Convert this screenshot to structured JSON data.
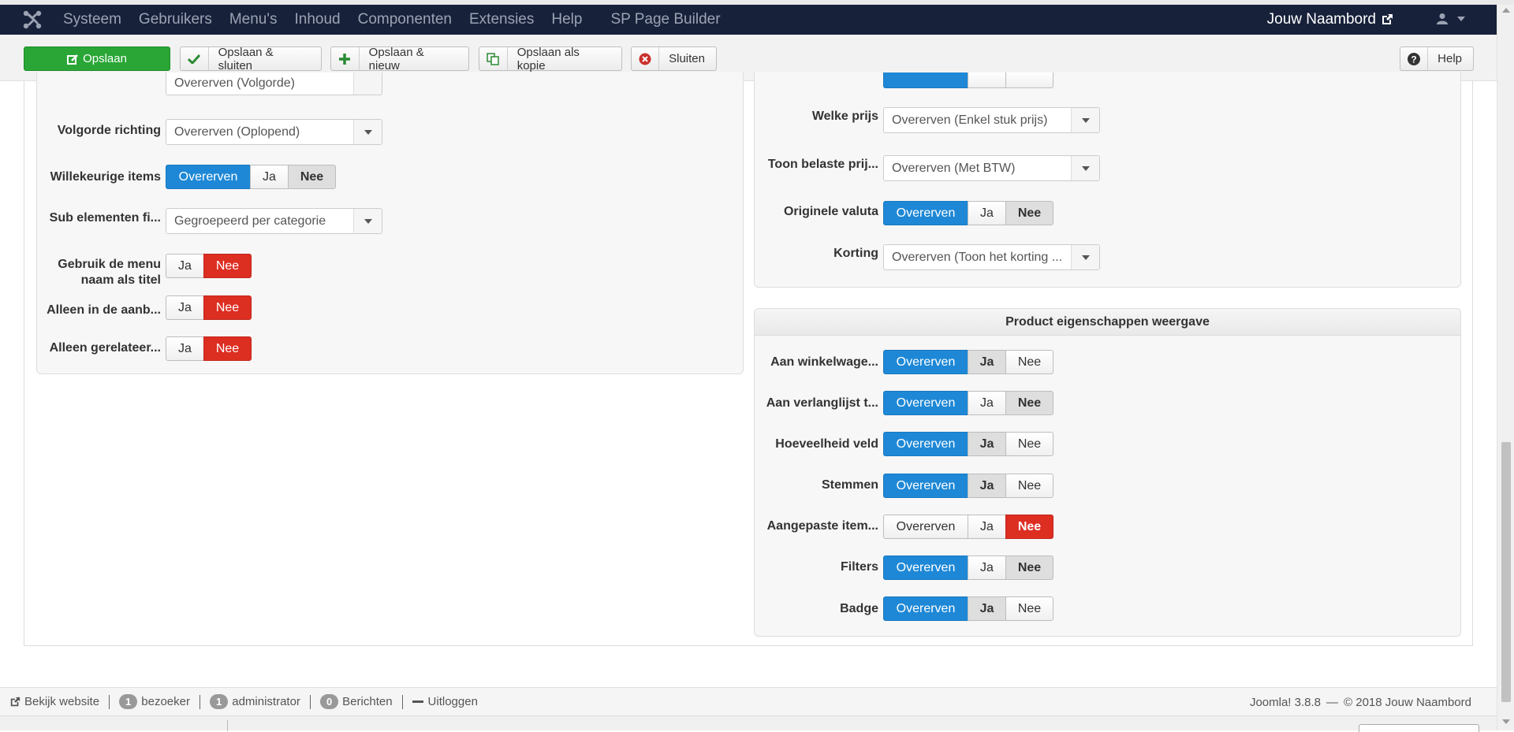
{
  "navbar": {
    "menu": [
      "Systeem",
      "Gebruikers",
      "Menu's",
      "Inhoud",
      "Componenten",
      "Extensies",
      "Help"
    ],
    "extra": "SP Page Builder",
    "brand": "Jouw Naambord"
  },
  "toolbar": {
    "save": "Opslaan",
    "save_close": "Opslaan & sluiten",
    "save_new": "Opslaan & nieuw",
    "save_copy": "Opslaan als kopie",
    "close": "Sluiten",
    "help": "Help"
  },
  "left_panel": {
    "partial_select": "Overerven (Volgorde)",
    "order_direction": {
      "label": "Volgorde richting",
      "value": "Overerven (Oplopend)"
    },
    "random_items": {
      "label": "Willekeurige items",
      "options": [
        "Overerven",
        "Ja",
        "Nee"
      ]
    },
    "sub_elements": {
      "label": "Sub elementen fi...",
      "value": "Gegroepeerd per categorie"
    },
    "menu_title": {
      "label": "Gebruik de menu naam als titel",
      "options": [
        "Ja",
        "Nee"
      ]
    },
    "only_offers": {
      "label": "Alleen in de aanb...",
      "options": [
        "Ja",
        "Nee"
      ]
    },
    "only_related": {
      "label": "Alleen gerelateer...",
      "options": [
        "Ja",
        "Nee"
      ]
    }
  },
  "right_top_panel": {
    "which_price": {
      "label": "Welke prijs",
      "value": "Overerven (Enkel stuk prijs)"
    },
    "taxed_price": {
      "label": "Toon belaste prij...",
      "value": "Overerven (Met BTW)"
    },
    "original_currency": {
      "label": "Originele valuta",
      "options": [
        "Overerven",
        "Ja",
        "Nee"
      ]
    },
    "discount": {
      "label": "Korting",
      "value": "Overerven (Toon het korting ..."
    }
  },
  "product_panel": {
    "title": "Product eigenschappen weergave",
    "rows": [
      {
        "label": "Aan winkelwage...",
        "options": [
          "Overerven",
          "Ja",
          "Nee"
        ]
      },
      {
        "label": "Aan verlanglijst t...",
        "options": [
          "Overerven",
          "Ja",
          "Nee"
        ]
      },
      {
        "label": "Hoeveelheid veld",
        "options": [
          "Overerven",
          "Ja",
          "Nee"
        ]
      },
      {
        "label": "Stemmen",
        "options": [
          "Overerven",
          "Ja",
          "Nee"
        ]
      },
      {
        "label": "Aangepaste item...",
        "options": [
          "Overerven",
          "Ja",
          "Nee"
        ]
      },
      {
        "label": "Filters",
        "options": [
          "Overerven",
          "Ja",
          "Nee"
        ]
      },
      {
        "label": "Badge",
        "options": [
          "Overerven",
          "Ja",
          "Nee"
        ]
      }
    ]
  },
  "status": {
    "view_site": "Bekijk website",
    "visitors_count": "1",
    "visitors_label": "bezoeker",
    "admins_count": "1",
    "admins_label": "administrator",
    "messages_count": "0",
    "messages_label": "Berichten",
    "logout": "Uitloggen",
    "version": "Joomla! 3.8.8",
    "copyright": "© 2018 Jouw Naambord",
    "dash": "—"
  },
  "colors": {
    "navbar_bg": "#17213a",
    "primary_green": "#2aa636",
    "active_blue": "#1e88d6",
    "active_red": "#dd2e22"
  }
}
